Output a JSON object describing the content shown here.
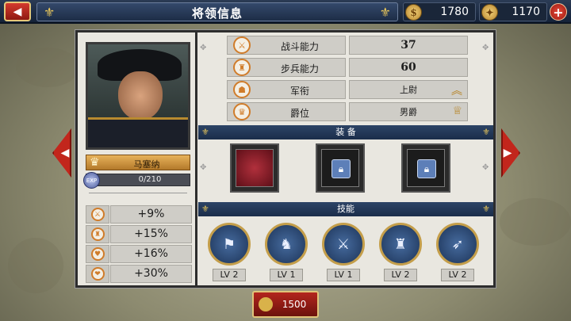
{
  "header": {
    "title": "将领信息",
    "back_icon": "back-arrow-icon",
    "title_ornament_icon": "fleur-de-lis-icon"
  },
  "resources": [
    {
      "icon": "gold-coin-icon",
      "value": "1780"
    },
    {
      "icon": "medal-icon",
      "value": "1170"
    }
  ],
  "add_button_symbol": "+",
  "general": {
    "name": "马塞纳",
    "exp": "0/210",
    "exp_label": "EXP",
    "exp_fraction": 0,
    "bonuses": [
      {
        "icon": "crossed-swords-icon",
        "value": "+9%"
      },
      {
        "icon": "soldier-icon",
        "value": "+15%"
      },
      {
        "icon": "heart-shield-icon",
        "value": "+16%"
      },
      {
        "icon": "heart-icon",
        "value": "+30%"
      }
    ]
  },
  "stats": [
    {
      "icon": "battle-icon",
      "label": "战斗能力",
      "value": "37"
    },
    {
      "icon": "infantry-icon",
      "label": "步兵能力",
      "value": "60"
    },
    {
      "icon": "rank-icon",
      "label": "军衔",
      "value": "上尉",
      "value_icon": "chevron-rank-icon"
    },
    {
      "icon": "crown-icon",
      "label": "爵位",
      "value": "男爵",
      "value_icon": "title-scroll-icon"
    }
  ],
  "equipment": {
    "header": "装 备",
    "slots": [
      {
        "state": "equipped",
        "icon": "red-banner-icon"
      },
      {
        "state": "locked",
        "icon": "lock-icon"
      },
      {
        "state": "locked",
        "icon": "lock-icon"
      }
    ]
  },
  "skills": {
    "header": "技能",
    "items": [
      {
        "icon": "infantry-charge-icon",
        "level": "LV 2"
      },
      {
        "icon": "musket-volley-icon",
        "level": "LV 1"
      },
      {
        "icon": "trench-rifleman-icon",
        "level": "LV 1"
      },
      {
        "icon": "grenadier-wreath-icon",
        "level": "LV 2"
      },
      {
        "icon": "bugle-icon",
        "level": "LV 2"
      }
    ]
  },
  "bottom_button": {
    "icon": "coin-icon",
    "value": "1500"
  },
  "colors": {
    "accent_gold": "#e8c65a",
    "header_blue": "#1b2d4a",
    "action_red": "#b3251d"
  }
}
